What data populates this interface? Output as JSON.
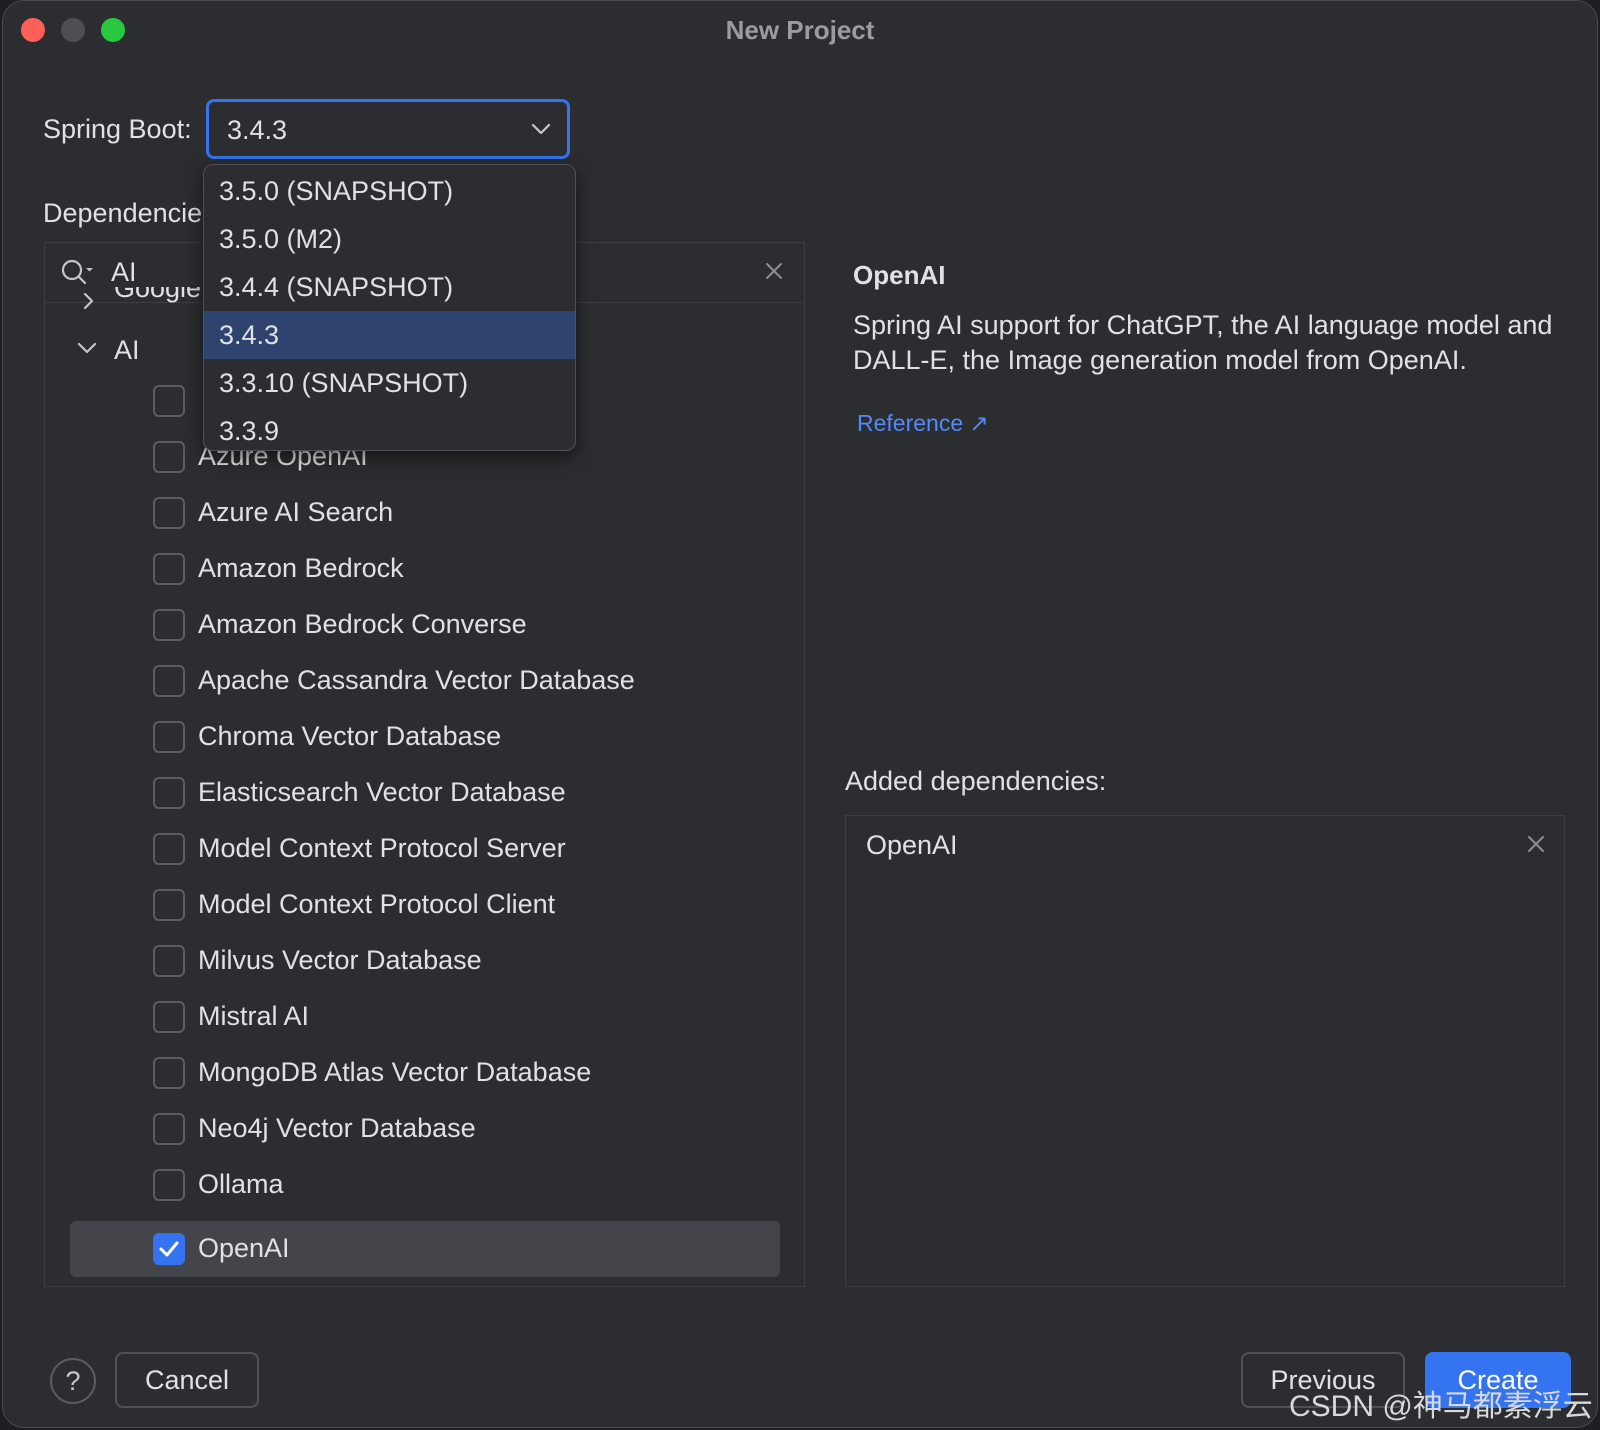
{
  "window": {
    "title": "New Project"
  },
  "spring_boot": {
    "label": "Spring Boot:",
    "selected": "3.4.3",
    "options": [
      "3.5.0 (SNAPSHOT)",
      "3.5.0 (M2)",
      "3.4.4 (SNAPSHOT)",
      "3.4.3",
      "3.3.10 (SNAPSHOT)",
      "3.3.9"
    ]
  },
  "dependencies": {
    "label": "Dependencies:",
    "search_value": "AI",
    "groups": [
      {
        "label": "Google",
        "expanded": false
      },
      {
        "label": "AI",
        "expanded": true
      }
    ],
    "items": [
      {
        "label": "Azure OpenAI",
        "checked": false
      },
      {
        "label": "Azure AI Search",
        "checked": false
      },
      {
        "label": "Amazon Bedrock",
        "checked": false
      },
      {
        "label": "Amazon Bedrock Converse",
        "checked": false
      },
      {
        "label": "Apache Cassandra Vector Database",
        "checked": false
      },
      {
        "label": "Chroma Vector Database",
        "checked": false
      },
      {
        "label": "Elasticsearch Vector Database",
        "checked": false
      },
      {
        "label": "Model Context Protocol Server",
        "checked": false
      },
      {
        "label": "Model Context Protocol Client",
        "checked": false
      },
      {
        "label": "Milvus Vector Database",
        "checked": false
      },
      {
        "label": "Mistral AI",
        "checked": false
      },
      {
        "label": "MongoDB Atlas Vector Database",
        "checked": false
      },
      {
        "label": "Neo4j Vector Database",
        "checked": false
      },
      {
        "label": "Ollama",
        "checked": false
      },
      {
        "label": "OpenAI",
        "checked": true
      }
    ]
  },
  "detail": {
    "title": "OpenAI",
    "description": "Spring AI support for ChatGPT, the AI language model and DALL-E, the Image generation model from OpenAI.",
    "reference_link": "Reference ↗"
  },
  "added": {
    "label": "Added dependencies:",
    "items": [
      "OpenAI"
    ]
  },
  "footer": {
    "help": "?",
    "cancel": "Cancel",
    "previous": "Previous",
    "create": "Create"
  },
  "watermark": "CSDN @神马都素浮云",
  "colors": {
    "accent": "#3574f0",
    "link": "#548af7",
    "background": "#2b2d30"
  }
}
